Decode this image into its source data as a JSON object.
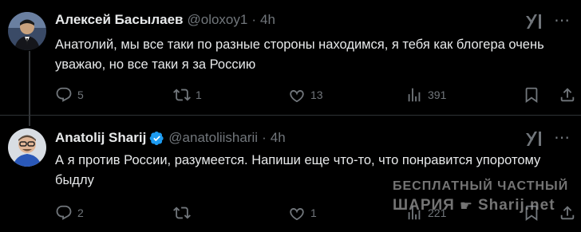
{
  "tweets": [
    {
      "name": "Алексей Басылаев",
      "handle": "@oloxoy1",
      "time": "4h",
      "text": "Анатолий, мы все таки по разные стороны находимся, я тебя как блогера очень уважаю, но все таки я за Россию",
      "replies": "5",
      "retweets": "1",
      "likes": "13",
      "views": "391",
      "verified": false
    },
    {
      "name": "Anatolij Sharij",
      "handle": "@anatoliisharii",
      "time": "4h",
      "text": "А я против России, разумеется. Напиши еще что-то, что понравится упоротому быдлу",
      "replies": "2",
      "retweets": "",
      "likes": "1",
      "views": "221",
      "verified": true
    }
  ],
  "watermark": {
    "line1": "БЕСПЛАТНЫЙ ЧАСТНЫЙ",
    "line2_left": "ШАРИЯ",
    "line2_right": "Sharij.net"
  },
  "colors": {
    "background": "#000000",
    "text": "#e7e9ea",
    "muted": "#71767b",
    "verified": "#1d9bf0"
  },
  "icons": [
    "reply-icon",
    "retweet-icon",
    "like-icon",
    "views-icon",
    "bookmark-icon",
    "share-icon",
    "grok-icon",
    "more-icon",
    "verified-icon"
  ]
}
